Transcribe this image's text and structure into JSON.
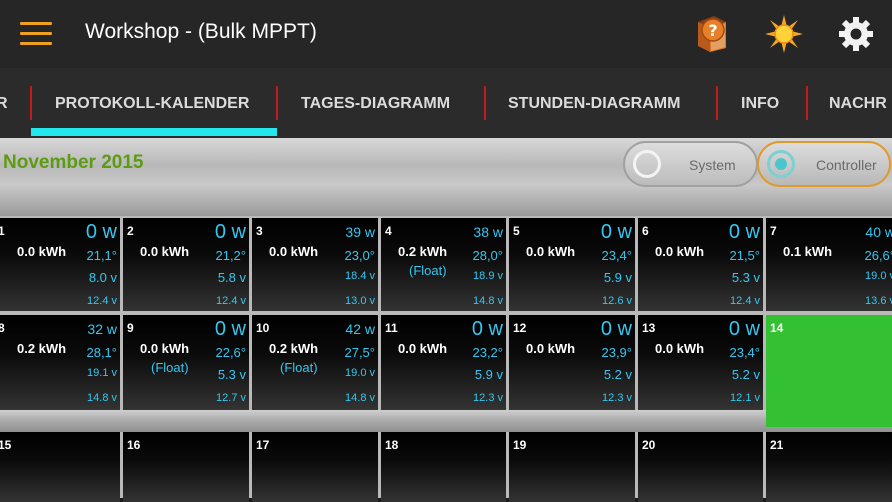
{
  "app": {
    "title": "Workshop - (Bulk MPPT)"
  },
  "tabs": [
    {
      "label": "R"
    },
    {
      "label": "PROTOKOLL-KALENDER"
    },
    {
      "label": "TAGES-DIAGRAMM"
    },
    {
      "label": "STUNDEN-DIAGRAMM"
    },
    {
      "label": "INFO"
    },
    {
      "label": "NACHR"
    }
  ],
  "calendar": {
    "month": "November 2015",
    "toggle": {
      "system_label": "System",
      "controller_label": "Controller",
      "selected": "Controller"
    },
    "week1": [
      {
        "day": "1",
        "power": "0 w",
        "energy": "0.0 kWh",
        "temp": "21,1°",
        "v1": "8.0 v",
        "v2": "12.4 v",
        "status": ""
      },
      {
        "day": "2",
        "power": "0 w",
        "energy": "0.0 kWh",
        "temp": "21,2°",
        "v1": "5.8 v",
        "v2": "12.4 v",
        "status": ""
      },
      {
        "day": "3",
        "power": "39 w",
        "energy": "0.0 kWh",
        "temp": "23,0°",
        "v1": "18.4 v",
        "v2": "13.0 v",
        "status": ""
      },
      {
        "day": "4",
        "power": "38 w",
        "energy": "0.2 kWh",
        "temp": "28,0°",
        "v1": "18.9 v",
        "v2": "14.8 v",
        "status": "(Float)"
      },
      {
        "day": "5",
        "power": "0 w",
        "energy": "0.0 kWh",
        "temp": "23,4°",
        "v1": "5.9 v",
        "v2": "12.6 v",
        "status": ""
      },
      {
        "day": "6",
        "power": "0 w",
        "energy": "0.0 kWh",
        "temp": "21,5°",
        "v1": "5.3 v",
        "v2": "12.4 v",
        "status": ""
      },
      {
        "day": "7",
        "power": "40 w",
        "energy": "0.1 kWh",
        "temp": "26,6°",
        "v1": "19.0 v",
        "v2": "13.6 v",
        "status": ""
      }
    ],
    "week2": [
      {
        "day": "8",
        "power": "32 w",
        "energy": "0.2 kWh",
        "temp": "28,1°",
        "v1": "19.1 v",
        "v2": "14.8 v",
        "status": ""
      },
      {
        "day": "9",
        "power": "0 w",
        "energy": "0.0 kWh",
        "temp": "22,6°",
        "v1": "5.3 v",
        "v2": "12.7 v",
        "status": "(Float)"
      },
      {
        "day": "10",
        "power": "42 w",
        "energy": "0.2 kWh",
        "temp": "27,5°",
        "v1": "19.0 v",
        "v2": "14.8 v",
        "status": "(Float)"
      },
      {
        "day": "11",
        "power": "0 w",
        "energy": "0.0 kWh",
        "temp": "23,2°",
        "v1": "5.9 v",
        "v2": "12.3 v",
        "status": ""
      },
      {
        "day": "12",
        "power": "0 w",
        "energy": "0.0 kWh",
        "temp": "23,9°",
        "v1": "5.2 v",
        "v2": "12.3 v",
        "status": ""
      },
      {
        "day": "13",
        "power": "0 w",
        "energy": "0.0 kWh",
        "temp": "23,4°",
        "v1": "5.2 v",
        "v2": "12.1 v",
        "status": ""
      },
      {
        "day": "14",
        "power": "",
        "energy": "",
        "temp": "",
        "v1": "",
        "v2": "",
        "status": "",
        "today": true
      }
    ],
    "week3": [
      {
        "day": "15"
      },
      {
        "day": "16"
      },
      {
        "day": "17"
      },
      {
        "day": "18"
      },
      {
        "day": "19"
      },
      {
        "day": "20"
      },
      {
        "day": "21"
      }
    ]
  },
  "icons": {
    "menu": "hamburger-menu-icon",
    "help": "help-book-icon",
    "weather": "sun-icon",
    "settings": "gear-icon"
  },
  "colors": {
    "accent_orange": "#f0a020",
    "tab_indicator": "#22e8ee",
    "tab_separator": "#c41a1a",
    "value_blue": "#36c7f0",
    "month_green": "#5d9b12",
    "today_green": "#33c033"
  }
}
